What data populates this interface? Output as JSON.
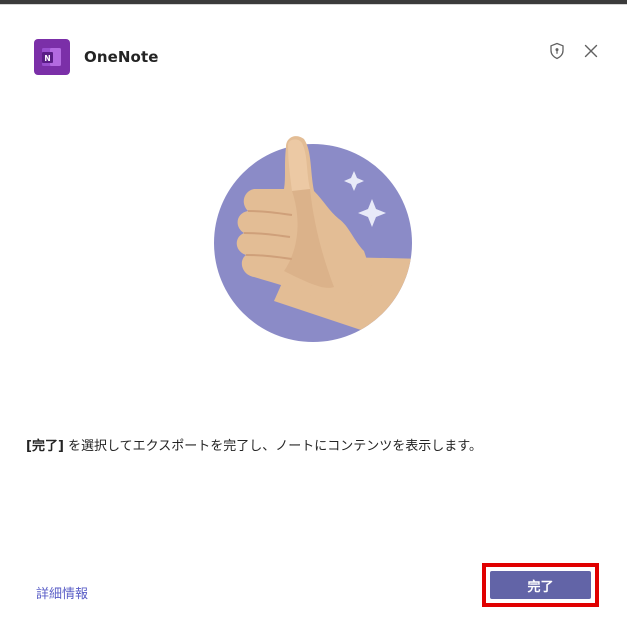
{
  "dialog": {
    "app_title": "OneNote",
    "app_icon": "onenote-icon",
    "header_icons": [
      "shield-icon",
      "close-icon"
    ]
  },
  "illustration": {
    "icon": "thumbs-up-illustration",
    "circle_color": "#8b8bc7",
    "hand_color": "#e3bd95",
    "sparkle_color": "#e8eaf8"
  },
  "message": {
    "bold_part": "[完了]",
    "rest": " を選択してエクスポートを完了し、ノートにコンテンツを表示します。"
  },
  "footer": {
    "more_info_link": "詳細情報",
    "done_button": "完了"
  },
  "colors": {
    "accent": "#6264a7",
    "link": "#5b5fc7",
    "highlight": "#e00000",
    "onenote_purple": "#7b2fa8"
  }
}
